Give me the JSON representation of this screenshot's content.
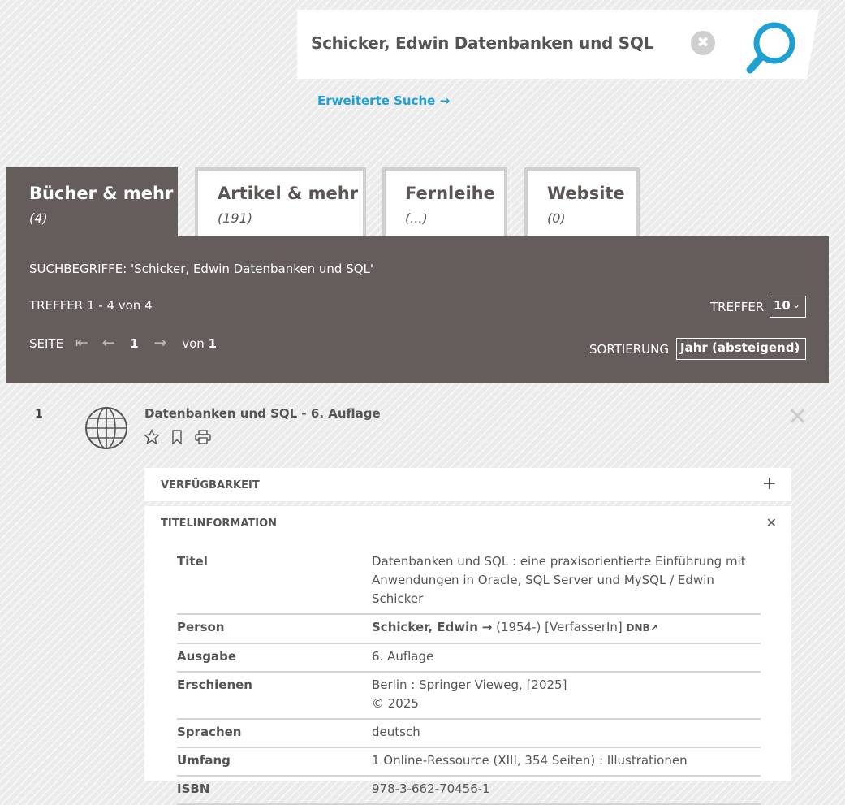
{
  "search": {
    "query": "Schicker, Edwin Datenbanken und SQL",
    "clear_symbol": "✖",
    "advanced_link": "Erweiterte Suche →"
  },
  "tabs": [
    {
      "label": "Bücher & mehr",
      "count": "(4)"
    },
    {
      "label": "Artikel & mehr",
      "count": "(191)"
    },
    {
      "label": "Fernleihe",
      "count": "(...)"
    },
    {
      "label": "Website",
      "count": "(0)"
    }
  ],
  "summary": {
    "search_terms": "SUCHBEGRIFFE: 'Schicker, Edwin Datenbanken und SQL'",
    "hits": "TREFFER 1 - 4 von 4",
    "page_label": "SEITE",
    "current_page": "1",
    "of_label": "von",
    "total_pages": "1",
    "per_page_label": "TREFFER",
    "per_page_value": "10",
    "sort_label": "SORTIERUNG",
    "sort_value": "Jahr (absteigend)"
  },
  "result": {
    "number": "1",
    "title": "Datenbanken und SQL - 6. Auflage",
    "availability_label": "VERFÜGBARKEIT",
    "titleinfo_label": "TITELINFORMATION",
    "details": {
      "titel_key": "Titel",
      "titel_value": "Datenbanken und SQL : eine praxisorientierte Einführung mit Anwendungen in Oracle, SQL Server und MySQL / Edwin Schicker",
      "person_key": "Person",
      "person_name": "Schicker, Edwin",
      "person_arrow": "→",
      "person_extra": "(1954-) [VerfasserIn]",
      "person_dnb": "DNB↗",
      "ausgabe_key": "Ausgabe",
      "ausgabe_value": "6. Auflage",
      "erschienen_key": "Erschienen",
      "erschienen_value": "Berlin : Springer Vieweg, [2025]",
      "erschienen_copyright": "© 2025",
      "sprachen_key": "Sprachen",
      "sprachen_value": "deutsch",
      "umfang_key": "Umfang",
      "umfang_value": "1 Online-Ressource (XIII, 354 Seiten) : Illustrationen",
      "isbn_key": "ISBN",
      "isbn_value": "978-3-662-70456-1"
    }
  },
  "icons": {
    "first_page": "⇤",
    "prev_page": "←",
    "next_page": "→",
    "expand": "+",
    "collapse": "✕",
    "close": "✕",
    "select_chevron": "⌄"
  }
}
